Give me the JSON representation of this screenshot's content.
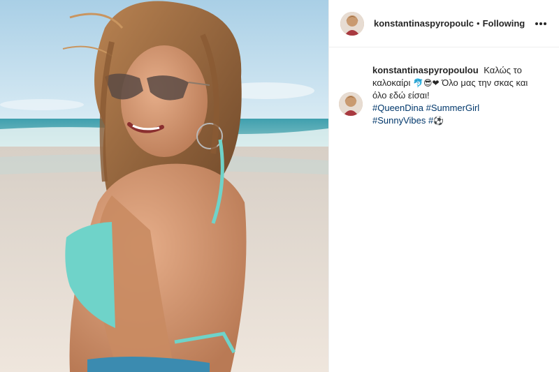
{
  "post": {
    "username": "konstantinaspyropoulc",
    "separator": "•",
    "follow_status": "Following",
    "more_icon": "ellipsis-icon",
    "caption": {
      "username": "konstantinaspyropoulou",
      "text_1": "Καλώς το καλοκαίρι",
      "emojis_1": "🐬😎❤",
      "text_2": "Όλο μας την σκας και όλο εδώ είσαι!",
      "hashtags": [
        "#QueenDina",
        "#SummerGirl",
        "#SunnyVibes",
        "#"
      ],
      "emoji_2": "⚽"
    },
    "colors": {
      "hashtag": "#00376b",
      "text": "#262626",
      "bikini": "#6fd3c9"
    }
  }
}
